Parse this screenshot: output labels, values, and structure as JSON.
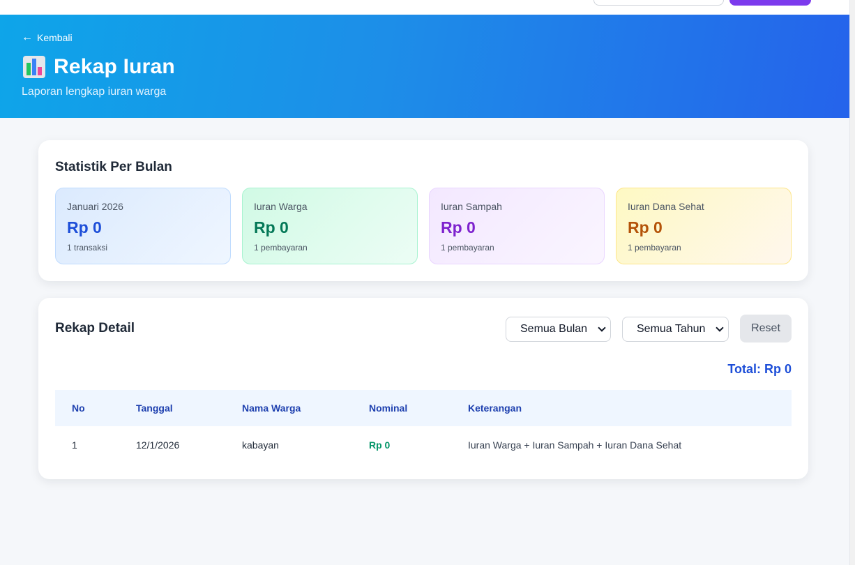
{
  "header": {
    "back_label": "Kembali",
    "back_icon": "left-arrow-icon",
    "title_icon": "bar-chart-icon",
    "title": "Rekap Iuran",
    "subtitle": "Laporan lengkap iuran warga"
  },
  "stats": {
    "heading": "Statistik Per Bulan",
    "cards": [
      {
        "label": "Januari 2026",
        "value": "Rp 0",
        "note": "1 transaksi",
        "color": "#1d4ed8"
      },
      {
        "label": "Iuran Warga",
        "value": "Rp 0",
        "note": "1 pembayaran",
        "color": "#047857"
      },
      {
        "label": "Iuran Sampah",
        "value": "Rp 0",
        "note": "1 pembayaran",
        "color": "#7e22ce"
      },
      {
        "label": "Iuran Dana Sehat",
        "value": "Rp 0",
        "note": "1 pembayaran",
        "color": "#b45309"
      }
    ]
  },
  "detail": {
    "heading": "Rekap Detail",
    "filters": {
      "month_selected": "Semua Bulan",
      "year_selected": "Semua Tahun",
      "reset_label": "Reset"
    },
    "total": "Total: Rp 0",
    "columns": [
      "No",
      "Tanggal",
      "Nama Warga",
      "Nominal",
      "Keterangan"
    ],
    "rows": [
      {
        "no": "1",
        "date": "12/1/2026",
        "name": "kabayan",
        "nominal": "Rp 0",
        "note": "Iuran Warga + Iuran Sampah + Iuran Dana Sehat"
      }
    ]
  },
  "colors": {
    "hero_start": "#0ea5e9",
    "hero_end": "#2563eb",
    "accent": "#1d4ed8",
    "nominal": "#059669"
  }
}
